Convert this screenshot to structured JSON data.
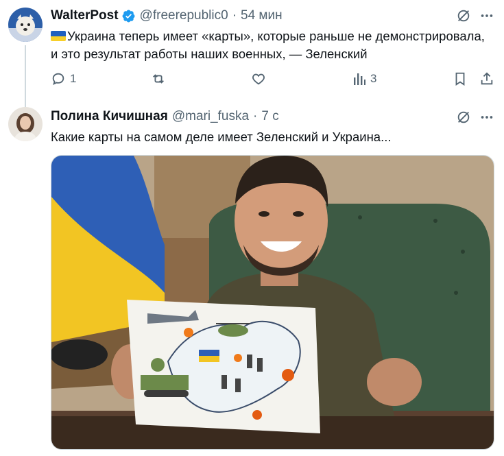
{
  "tweet1": {
    "name": "WalterPost",
    "handle": "@freerepublic0",
    "time": "54 мин",
    "text_line1": "Украина теперь имеет «карты», которые раньше не демонстрировала,",
    "text_line2": "и это результат работы наших военных, — Зеленский",
    "reply_count": "1",
    "views_count": "3",
    "icons": [
      "grok-icon",
      "more-icon",
      "reply-icon",
      "retweet-icon",
      "like-icon",
      "views-icon",
      "bookmark-icon",
      "share-icon"
    ]
  },
  "tweet2": {
    "name": "Полина Кичишная",
    "handle": "@mari_fuska",
    "time": "7 с",
    "text": "Какие карты на самом деле имеет Зеленский и Украина...",
    "icons": [
      "grok-icon",
      "more-icon"
    ]
  },
  "colors": {
    "verified": "#1d9bf0",
    "secondary_text": "#536471",
    "divider": "#eff3f4",
    "flag_blue": "#1f5fbf",
    "flag_yellow": "#f7cf2a"
  }
}
